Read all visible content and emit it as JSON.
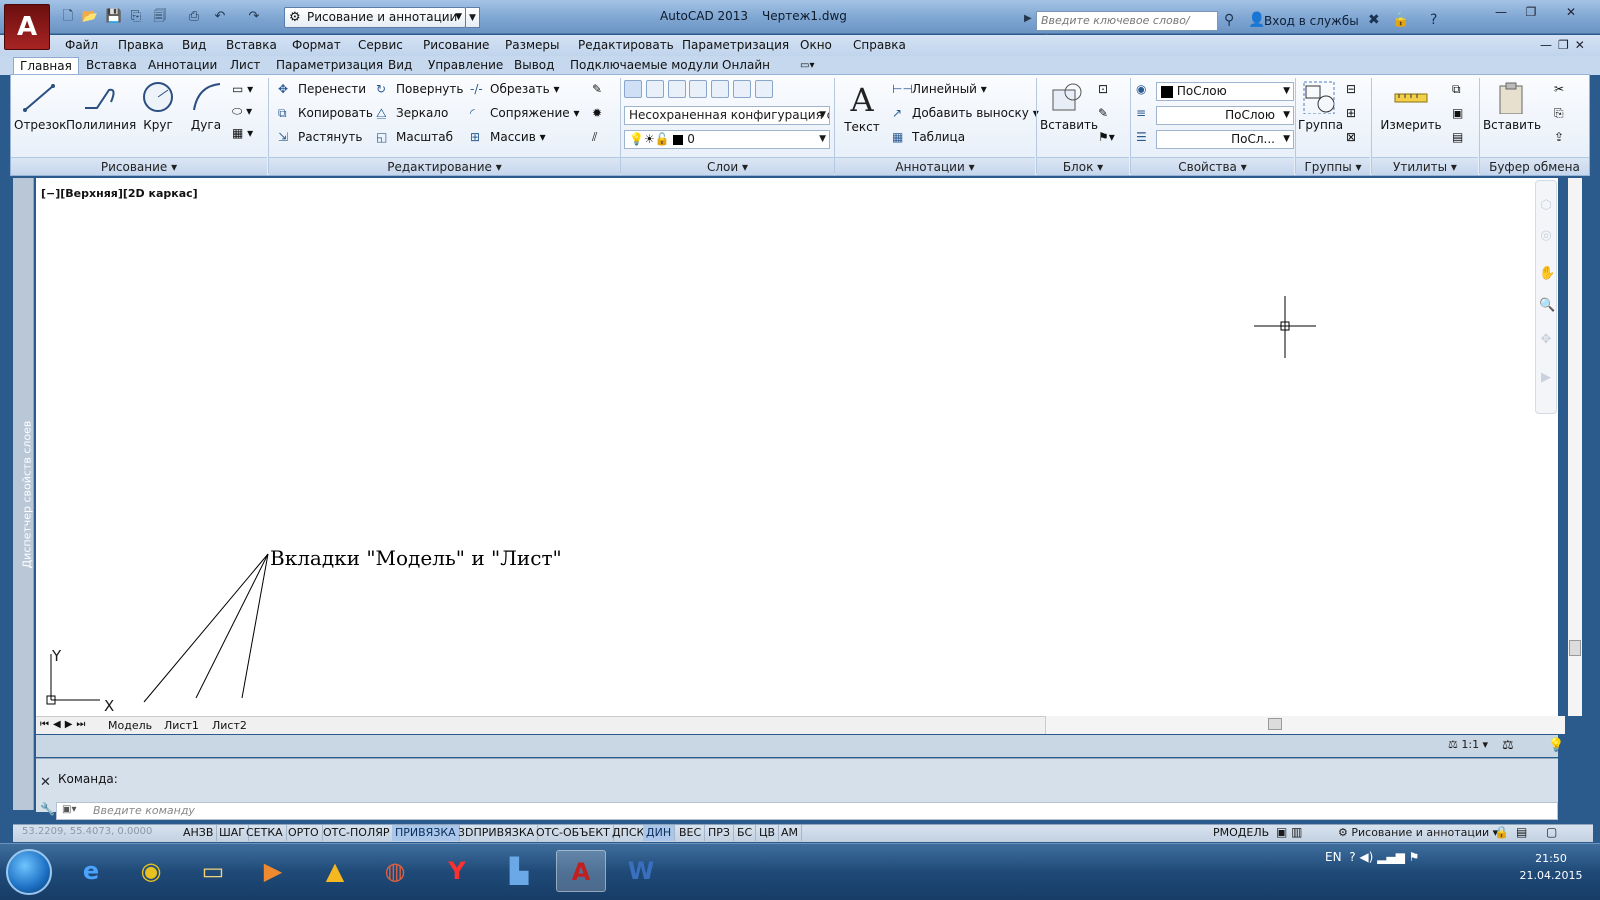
{
  "app": {
    "logo_letter": "A",
    "title": "AutoCAD 2013",
    "file": "Чертеж1.dwg",
    "workspace": "Рисование и аннотации",
    "search_placeholder": "Введите ключевое слово/фразу",
    "signin": "Вход в службы"
  },
  "menu": [
    "Файл",
    "Правка",
    "Вид",
    "Вставка",
    "Формат",
    "Сервис",
    "Рисование",
    "Размеры",
    "Редактировать",
    "Параметризация",
    "Окно",
    "Справка"
  ],
  "ribbon_tabs": [
    "Главная",
    "Вставка",
    "Аннотации",
    "Лист",
    "Параметризация",
    "Вид",
    "Управление",
    "Вывод",
    "Подключаемые модули",
    "Онлайн"
  ],
  "panels": {
    "draw": {
      "title": "Рисование",
      "line": "Отрезок",
      "polyline": "Полилиния",
      "circle": "Круг",
      "arc": "Дуга"
    },
    "modify": {
      "title": "Редактирование",
      "move": "Перенести",
      "rotate": "Повернуть",
      "trim": "Обрезать",
      "copy": "Копировать",
      "mirror": "Зеркало",
      "fillet": "Сопряжение",
      "stretch": "Растянуть",
      "scale": "Масштаб",
      "array": "Массив"
    },
    "layers": {
      "title": "Слои",
      "config": "Несохраненная конфигурация слоев",
      "current": "0"
    },
    "annotation": {
      "title": "Аннотации",
      "text": "Текст",
      "linear": "Линейный",
      "leader": "Добавить выноску",
      "table": "Таблица"
    },
    "block": {
      "title": "Блок",
      "insert": "Вставить"
    },
    "properties": {
      "title": "Свойства",
      "color": "ПоСлою",
      "lineweight": "ПоСлою",
      "linetype": "ПоСл..."
    },
    "groups": {
      "title": "Группы",
      "group": "Группа"
    },
    "utilities": {
      "title": "Утилиты",
      "measure": "Измерить"
    },
    "clipboard": {
      "title": "Буфер обмена",
      "paste": "Вставить"
    }
  },
  "viewport": {
    "label": "[−][Верхняя][2D каркас]",
    "annotation": "Вкладки \"Модель\" и \"Лист\"",
    "ucs_x": "X",
    "ucs_y": "Y"
  },
  "layout_tabs": [
    "Модель",
    "Лист1",
    "Лист2"
  ],
  "left_palette": "Диспетчер свойств слоев",
  "command": {
    "label": "Команда:",
    "placeholder": "Введите команду"
  },
  "status": {
    "coords": "53.2209, 55.4073, 0.0000",
    "toggles": [
      {
        "label": "АНЗВ",
        "on": false
      },
      {
        "label": "ШАГ",
        "on": false
      },
      {
        "label": "СЕТКА",
        "on": false
      },
      {
        "label": "ОРТО",
        "on": false
      },
      {
        "label": "ОТС-ПОЛЯР",
        "on": false
      },
      {
        "label": "ПРИВЯЗКА",
        "on": true
      },
      {
        "label": "3DПРИВЯЗКА",
        "on": false
      },
      {
        "label": "ОТС-ОБЪЕКТ",
        "on": false
      },
      {
        "label": "ДПСК",
        "on": false
      },
      {
        "label": "ДИН",
        "on": true
      },
      {
        "label": "ВЕС",
        "on": false
      },
      {
        "label": "ПРЗ",
        "on": false
      },
      {
        "label": "БС",
        "on": false
      },
      {
        "label": "ЦВ",
        "on": false
      },
      {
        "label": "АМ",
        "on": false
      }
    ],
    "model": "РМОДЕЛЬ",
    "workspace": "Рисование и аннотации",
    "scale": "1:1"
  },
  "taskbar": {
    "lang": "EN",
    "time": "21:50",
    "date": "21.04.2015"
  },
  "colors": {
    "accent": "#aac6e8",
    "autocad_red": "#a82424",
    "taskbar": "#1f4a78"
  }
}
